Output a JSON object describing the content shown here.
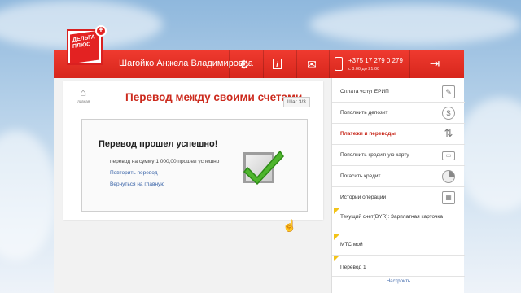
{
  "header": {
    "logo_text": "ДЕЛЬТА ПЛЮС",
    "username": "Шагойко Анжела Владимировна",
    "phone": "+375 17 279 0 279",
    "phone_hours": "с 8:00 до 21:00",
    "icons": [
      "gear-icon",
      "info-icon",
      "message-icon",
      "phone-icon",
      "exit-icon"
    ],
    "accent": "#e32222"
  },
  "main": {
    "home_label": "главная",
    "title": "Перевод между своими счетами",
    "step": "Шаг 3/3",
    "result": {
      "title": "Перевод прошел успешно!",
      "text": "перевод на сумму 1 000,00 прошел успешно",
      "repeat_link": "Повторить перевод",
      "back_link": "Вернуться на главную"
    }
  },
  "sidebar": {
    "items": [
      {
        "label": "Оплата услуг ЕРИП",
        "icon": "edit-icon"
      },
      {
        "label": "Пополнить депозит",
        "icon": "money-bag-icon"
      },
      {
        "label": "Платежи и переводы",
        "icon": "transfer-icon"
      },
      {
        "label": "Пополнить кредитную карту",
        "icon": "card-icon"
      },
      {
        "label": "Погасить кредит",
        "icon": "pie-chart-icon"
      },
      {
        "label": "Истории операций",
        "icon": "calendar-icon"
      }
    ],
    "favorites": [
      {
        "label": "Текущий счет(BYR): Зарплатная карточка"
      },
      {
        "label": "МТС мой"
      },
      {
        "label": "Перевод 1"
      }
    ],
    "setup_label": "Настроить"
  }
}
